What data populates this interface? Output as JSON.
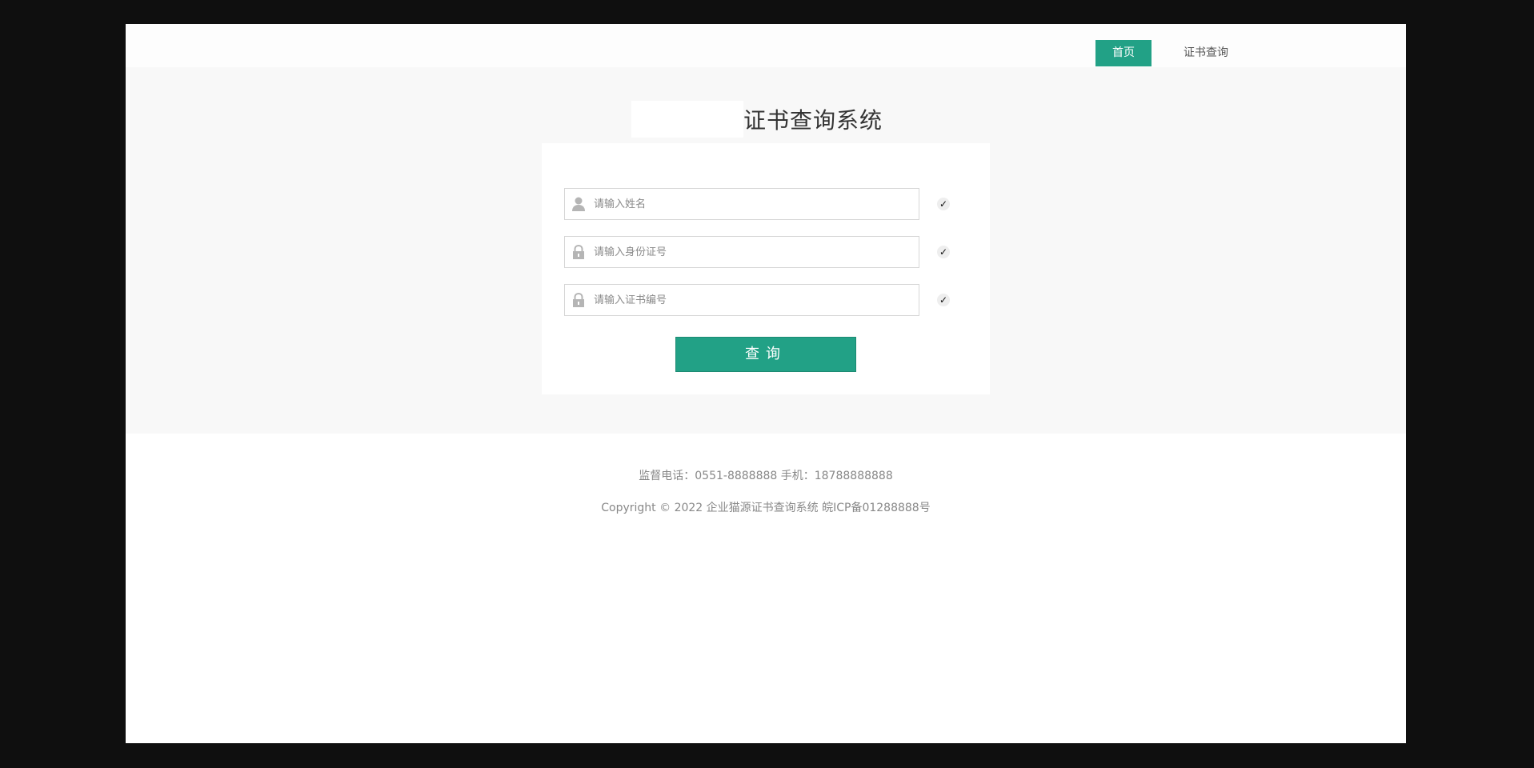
{
  "nav": {
    "home_label": "首页",
    "query_label": "证书查询"
  },
  "main": {
    "title": "证书查询系统"
  },
  "form": {
    "name_placeholder": "请输入姓名",
    "id_placeholder": "请输入身份证号",
    "cert_placeholder": "请输入证书编号",
    "check_mark": "✓",
    "submit_label": "查询"
  },
  "footer": {
    "contact": "监督电话：0551-8888888  手机：18788888888",
    "copyright": "Copyright © 2022 企业猫源证书查询系统 皖ICP备01288888号"
  },
  "colors": {
    "accent": "#22a186",
    "page_bg": "#f8f8f8",
    "outer_bg": "#0f0f0f"
  },
  "icons": {
    "name_field": "user-icon",
    "id_field": "lock-icon",
    "cert_field": "lock-icon",
    "validation": "check-icon"
  }
}
